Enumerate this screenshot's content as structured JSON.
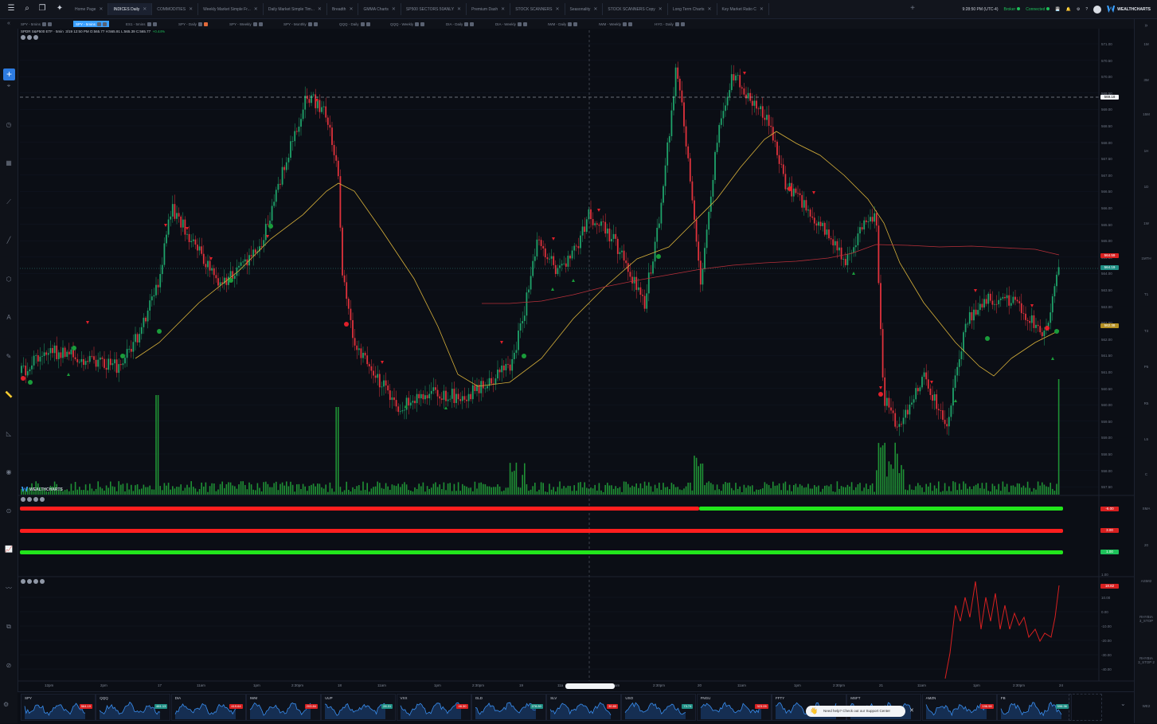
{
  "topbar": {
    "tabs": [
      {
        "label": "Home Page",
        "active": false
      },
      {
        "label": "INDICES Daily",
        "active": true
      },
      {
        "label": "COMMODITIES",
        "active": false
      },
      {
        "label": "Weekly Market Simple Fr...",
        "active": false
      },
      {
        "label": "Daily Market Simple Tim...",
        "active": false
      },
      {
        "label": "Breadth",
        "active": false
      },
      {
        "label": "GMMA Charts",
        "active": false
      },
      {
        "label": "SP500 SECTORS 50ANLY",
        "active": false
      },
      {
        "label": "Premium Dash",
        "active": false
      },
      {
        "label": "STOCK SCANNERS",
        "active": false
      },
      {
        "label": "Seasonality",
        "active": false
      },
      {
        "label": "STOCK SCANNERS Copy",
        "active": false
      },
      {
        "label": "Long Term Charts",
        "active": false
      },
      {
        "label": "Key Market Ratio C",
        "active": false
      }
    ],
    "time": "9:28:50 PM (UTC-4)",
    "broker": "Broker",
    "status": "Connected",
    "brand": "WEALTHCHARTS"
  },
  "symbol_tabs": [
    {
      "label": "SPY - 5mins",
      "active": false
    },
    {
      "label": "SPY - 5mins",
      "active": true
    },
    {
      "label": "ES1 - 5mins",
      "active": false
    },
    {
      "label": "SPY - Daily",
      "active": false
    },
    {
      "label": "SPY - Weekly",
      "active": false
    },
    {
      "label": "SPY - Monthly",
      "active": false
    },
    {
      "label": "QQQ - Daily",
      "active": false
    },
    {
      "label": "QQQ - Weekly",
      "active": false
    },
    {
      "label": "DIA - Daily",
      "active": false
    },
    {
      "label": "DIA - Weekly",
      "active": false
    },
    {
      "label": "IWM - Daily",
      "active": false
    },
    {
      "label": "IWM - Weekly",
      "active": false
    },
    {
      "label": "HYG - Daily",
      "active": false
    }
  ],
  "legend": {
    "symbol": "SPDR S&P500 ETF · 5min",
    "values": "3/19 12:50 PM O:565.77 H:565.91 L:565.39 C:565.77",
    "change": "+0.44%"
  },
  "timeframes": [
    "1M",
    "3M",
    "15M",
    "1H",
    "1D",
    "1W",
    "1MTH",
    "T1",
    "T3",
    "P5",
    "R5",
    "L5",
    "C"
  ],
  "timeframes_lower": [
    "SMA",
    "20",
    "ASMI2",
    "RHYBIA 3_STOP",
    "RHYBIA 3_STOP 2",
    "WE2"
  ],
  "price_axis": [
    "571.00",
    "570.50",
    "570.00",
    "569.50",
    "569.00",
    "568.50",
    "568.00",
    "567.50",
    "567.00",
    "566.50",
    "566.00",
    "565.50",
    "565.00",
    "564.50",
    "564.00",
    "563.50",
    "563.00",
    "562.50",
    "562.00",
    "561.50",
    "561.00",
    "560.50",
    "560.00",
    "559.50",
    "559.00",
    "558.50",
    "558.00",
    "557.50"
  ],
  "price_labels": {
    "last": "564.59",
    "current": "564.19",
    "ma": "562.38",
    "crosshair": "569.18"
  },
  "indicator_labels": {
    "ind1": "-6.00",
    "ind2": "3.00",
    "ind3": "1.00"
  },
  "osc_axis": [
    "1.00",
    "20.00",
    "10.00",
    "0.00",
    "-10.00",
    "-20.00",
    "-30.00",
    "-40.00"
  ],
  "osc_label": "18.82",
  "time_axis": [
    "12pm",
    "2pm",
    "17",
    "11am",
    "1pm",
    "2:30pm",
    "18",
    "11am",
    "1pm",
    "2:30pm",
    "19",
    "11a",
    "am",
    "2:30pm",
    "20",
    "11am",
    "1pm",
    "2:30pm",
    "21",
    "11am",
    "1pm",
    "2:30pm",
    "24"
  ],
  "watermark": "WEALTHCHARTS",
  "colors": {
    "up": "#1fa36a",
    "down": "#e0323c",
    "ma": "#d8b13a",
    "ma_long": "#b7303a",
    "bar_red": "#ff1e1e",
    "bar_green": "#22e51c",
    "volume": "#21a038",
    "accent": "#2d7be0"
  },
  "watchlist": [
    {
      "symbol": "SPY",
      "price": "564.19",
      "dir": "down"
    },
    {
      "symbol": "QQQ",
      "price": "481.13",
      "dir": "up"
    },
    {
      "symbol": "DIA",
      "price": "419.64",
      "dir": "down"
    },
    {
      "symbol": "IWM",
      "price": "203.84",
      "dir": "down"
    },
    {
      "symbol": "UUP",
      "price": "28.31",
      "dir": "up"
    },
    {
      "symbol": "VXX",
      "price": "46.30",
      "dir": "down"
    },
    {
      "symbol": "GLD",
      "price": "278.80",
      "dir": "up"
    },
    {
      "symbol": "SLV",
      "price": "30.80",
      "dir": "down"
    },
    {
      "symbol": "USO",
      "price": "73.74",
      "dir": "up"
    },
    {
      "symbol": "FNGU",
      "price": "323.05",
      "dir": "down"
    },
    {
      "symbol": "FFTY",
      "price": "",
      "dir": "up"
    },
    {
      "symbol": "MSFT",
      "price": "",
      "dir": "up"
    },
    {
      "symbol": "AMZN",
      "price": "196.98",
      "dir": "down"
    },
    {
      "symbol": "FB",
      "price": "596.36",
      "dir": "up"
    }
  ],
  "help": {
    "text": "Need help? Check out our Support Center"
  }
}
